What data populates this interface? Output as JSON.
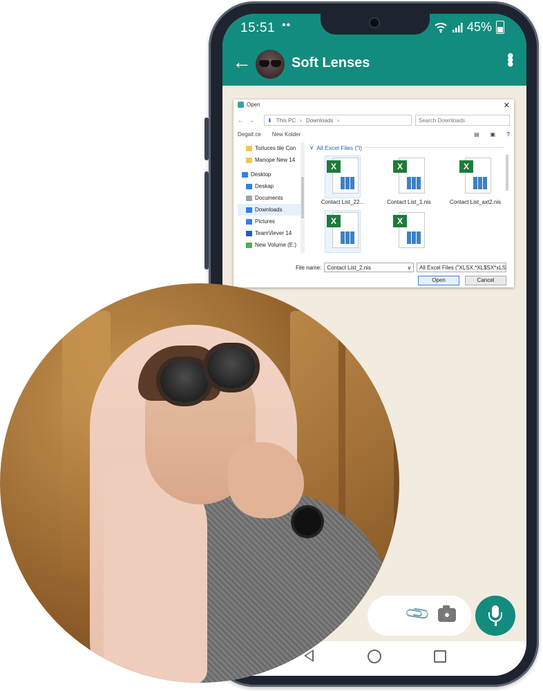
{
  "status_bar": {
    "time": "15:51",
    "dots": "••",
    "battery": "45%"
  },
  "chat": {
    "contact_name": "Soft Lenses"
  },
  "dialog": {
    "title": "Open",
    "breadcrumb": [
      "This PC",
      "Downloads"
    ],
    "search_placeholder": "Search Downloads",
    "toolbar": {
      "organize": "Degait.ce",
      "new_folder": "New Kolder"
    },
    "sidebar_items": [
      {
        "label": "Torluces tile Con",
        "color": "#f2c94c"
      },
      {
        "label": "Manope New 14",
        "color": "#f2c94c"
      },
      {
        "label": "Desktop",
        "color": "#2f80ed"
      },
      {
        "label": "Deskap",
        "color": "#2f80ed"
      },
      {
        "label": "Documents",
        "color": "#9aa5b1"
      },
      {
        "label": "Downloads",
        "color": "#2f80ed"
      },
      {
        "label": "Pictures",
        "color": "#2f80ed"
      },
      {
        "label": "TeamViever 14",
        "color": "#1f5fbf"
      },
      {
        "label": "New Volume (E:)",
        "color": "#4caf50"
      }
    ],
    "group_label": "All Excel Files (\"l)",
    "files": [
      {
        "name": "Contact List_22..."
      },
      {
        "name": "Contact List_1.nis"
      },
      {
        "name": "Contact List_axt2.nis"
      },
      {
        "name": ""
      },
      {
        "name": ""
      }
    ],
    "file_name_label": "File name:",
    "file_name_value": "Contact List_2.nis",
    "file_type": "All Excel Files (\"XLSX,*XL$SX*xLS)",
    "open_button": "Open",
    "cancel_button": "Cancel"
  },
  "colors": {
    "brand": "#128c7e",
    "chat_background": "#f2ebdf"
  }
}
